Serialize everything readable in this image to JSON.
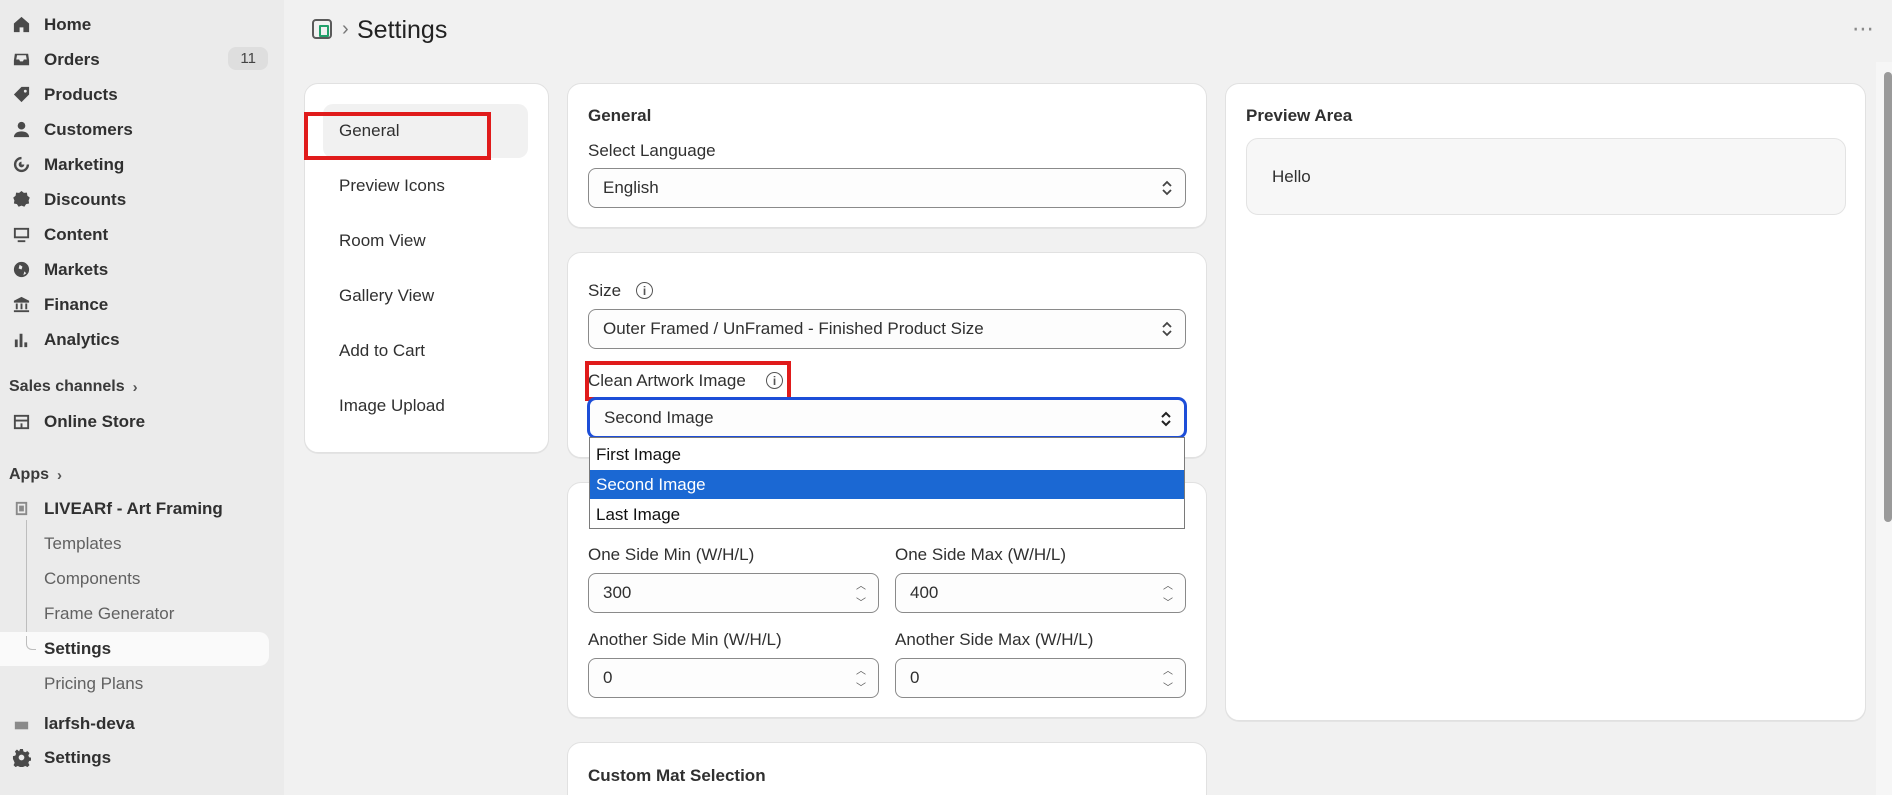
{
  "sidebar": {
    "items": [
      {
        "label": "Home",
        "icon": "home-icon"
      },
      {
        "label": "Orders",
        "icon": "inbox-icon",
        "badge": "11"
      },
      {
        "label": "Products",
        "icon": "tag-icon"
      },
      {
        "label": "Customers",
        "icon": "person-icon"
      },
      {
        "label": "Marketing",
        "icon": "target-icon"
      },
      {
        "label": "Discounts",
        "icon": "discount-icon"
      },
      {
        "label": "Content",
        "icon": "content-icon"
      },
      {
        "label": "Markets",
        "icon": "globe-icon"
      },
      {
        "label": "Finance",
        "icon": "bank-icon"
      },
      {
        "label": "Analytics",
        "icon": "chart-icon"
      }
    ],
    "sales_channels_label": "Sales channels",
    "online_store": "Online Store",
    "apps_label": "Apps",
    "app_name": "LIVEARf - Art Framing",
    "app_sub_items": [
      "Templates",
      "Components",
      "Frame Generator",
      "Settings",
      "Pricing Plans"
    ],
    "other_app": "larfsh-deva",
    "settings": "Settings"
  },
  "header": {
    "title": "Settings",
    "more": "⋯"
  },
  "settings_menu": [
    "General",
    "Preview Icons",
    "Room View",
    "Gallery View",
    "Add to Cart",
    "Image Upload"
  ],
  "general_card": {
    "title": "General",
    "language_label": "Select Language",
    "language_value": "English"
  },
  "size_card": {
    "size_label": "Size",
    "size_value": "Outer Framed / UnFramed - Finished Product Size",
    "clean_label": "Clean Artwork Image",
    "clean_value": "Second Image",
    "options": [
      "First Image",
      "Second Image",
      "Last Image"
    ],
    "selected_option": "Second Image"
  },
  "limits_card": {
    "one_min_label": "One Side Min (W/H/L)",
    "one_min_value": "300",
    "one_max_label": "One Side Max (W/H/L)",
    "one_max_value": "400",
    "another_min_label": "Another Side Min (W/H/L)",
    "another_min_value": "0",
    "another_max_label": "Another Side Max (W/H/L)",
    "another_max_value": "0"
  },
  "mat_card": {
    "title": "Custom Mat Selection"
  },
  "preview": {
    "title": "Preview Area",
    "text": "Hello"
  },
  "colors": {
    "highlight_red": "#e01b1b",
    "select_blue": "#1b68d3",
    "focus_blue": "#1d4ed8"
  }
}
